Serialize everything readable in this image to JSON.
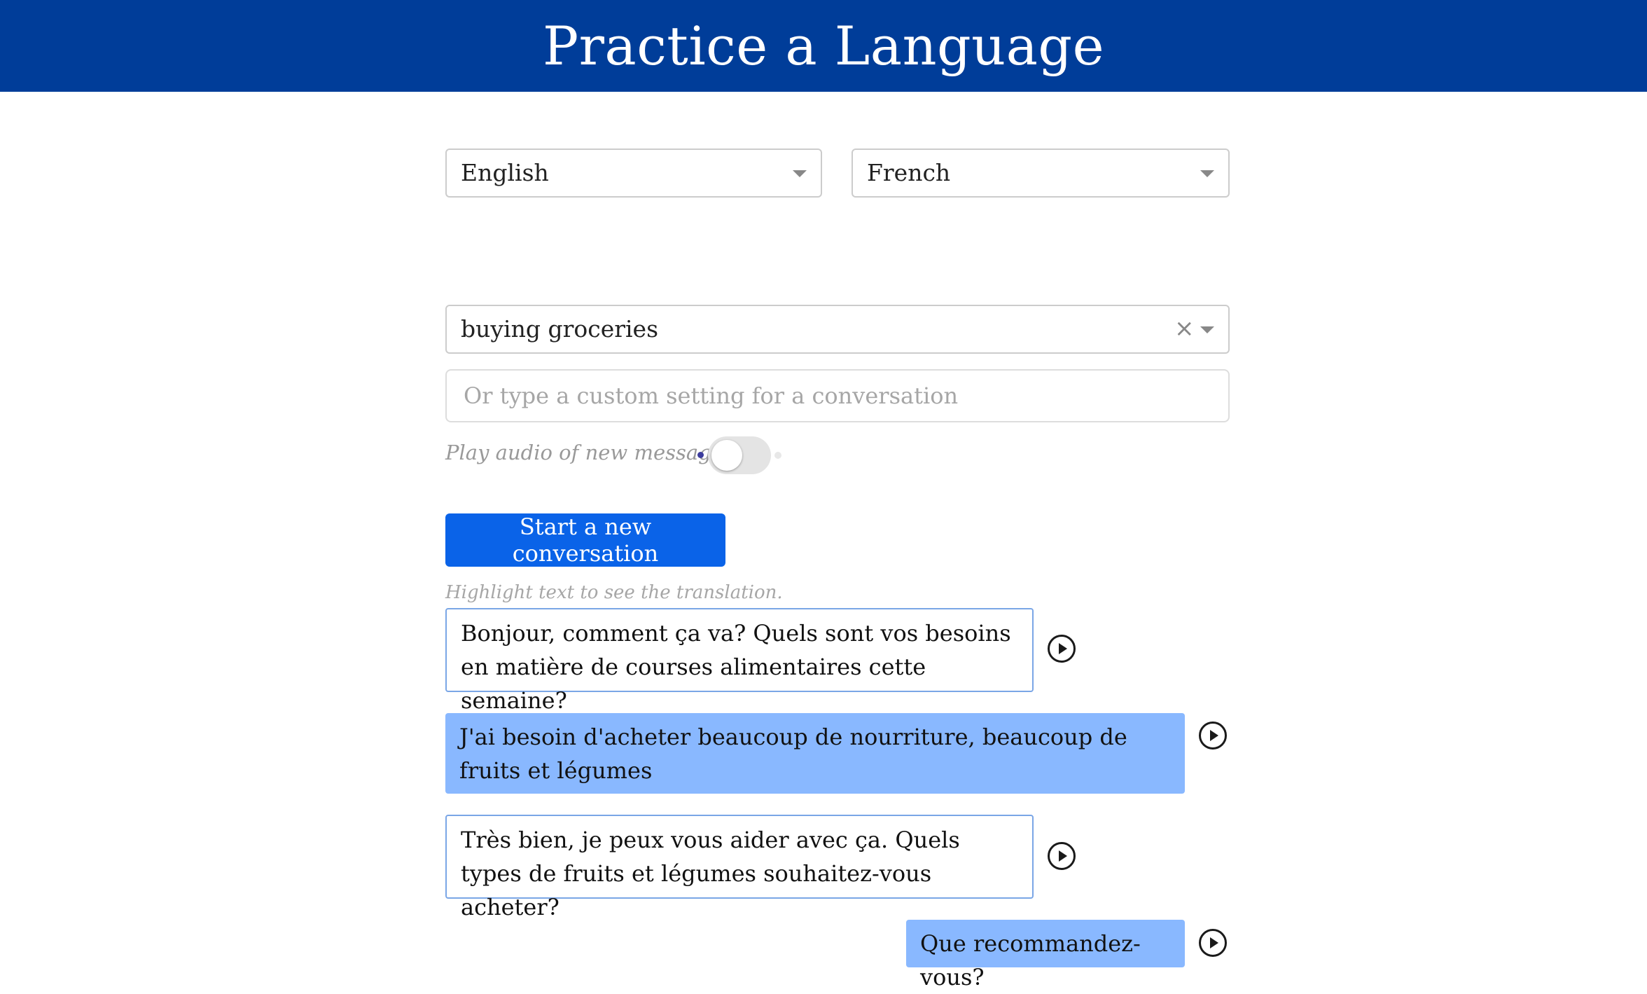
{
  "header": {
    "title": "Practice a Language"
  },
  "selects": {
    "native_language": "English",
    "target_language": "French",
    "topic": "buying groceries"
  },
  "custom_setting": {
    "placeholder": "Or type a custom setting for a conversation",
    "value": ""
  },
  "audio_toggle": {
    "label": "Play audio of new message",
    "on": false
  },
  "start_button": {
    "label": "Start a new conversation"
  },
  "hint": "Highlight text to see the translation.",
  "messages": [
    {
      "role": "assistant",
      "text": "Bonjour, comment ça va? Quels sont vos besoins en matière de courses alimentaires cette semaine?"
    },
    {
      "role": "user",
      "text": "J'ai besoin d'acheter beaucoup de nourriture, beaucoup de fruits et légumes"
    },
    {
      "role": "assistant",
      "text": "Très bien, je peux vous aider avec ça. Quels types de fruits et légumes souhaitez-vous acheter?"
    },
    {
      "role": "user",
      "text": "Que recommandez-vous?"
    }
  ],
  "icons": {
    "dropdown": "chevron-down-icon",
    "clear": "close-icon",
    "play": "play-circle-icon"
  },
  "colors": {
    "header_bg": "#003d99",
    "primary_button": "#0a63e8",
    "user_bubble": "#89b8ff",
    "assistant_border": "#7aa6e6"
  }
}
